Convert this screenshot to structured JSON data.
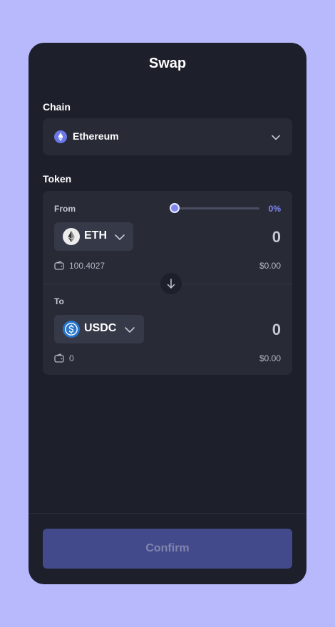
{
  "header": {
    "title": "Swap"
  },
  "chain": {
    "label": "Chain",
    "selected": "Ethereum",
    "icon": "ethereum-icon"
  },
  "token": {
    "label": "Token",
    "from": {
      "label": "From",
      "symbol": "ETH",
      "icon": "eth-token-icon",
      "amount": "0",
      "balance": "100.4027",
      "usd_value": "$0.00",
      "slider_percent": 0,
      "slider_percent_label": "0%"
    },
    "to": {
      "label": "To",
      "symbol": "USDC",
      "icon": "usdc-token-icon",
      "amount": "0",
      "balance": "0",
      "usd_value": "$0.00"
    }
  },
  "actions": {
    "confirm_label": "Confirm"
  },
  "colors": {
    "page_bg": "#b7b9fc",
    "panel_bg": "#1d1f2b",
    "card_bg": "#282a36",
    "accent": "#7f86f0",
    "confirm_bg": "#434a8c"
  }
}
